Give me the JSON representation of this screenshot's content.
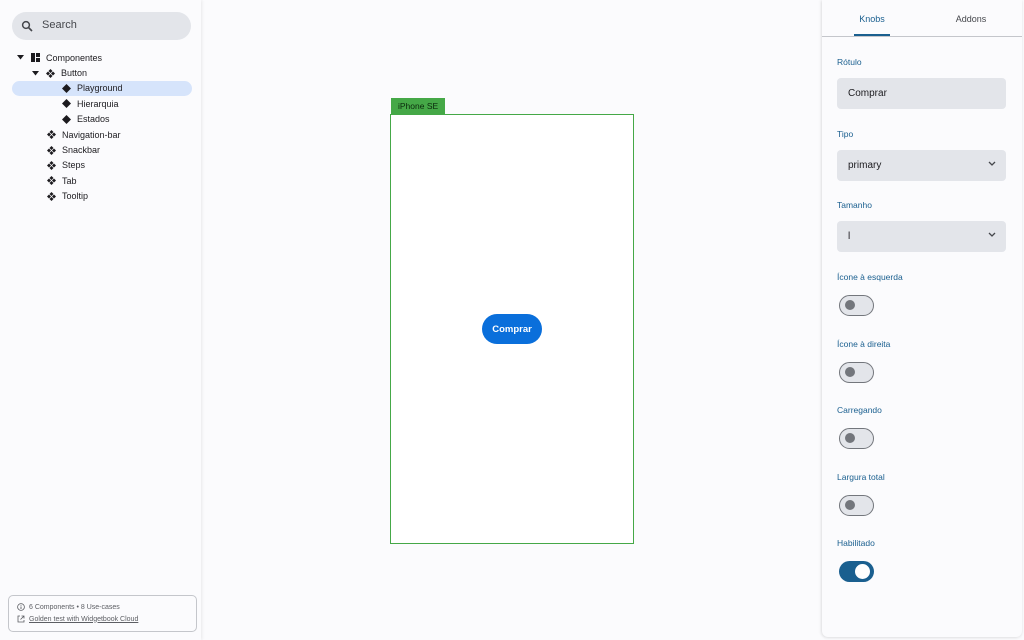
{
  "sidebar": {
    "search": {
      "placeholder": "Search"
    },
    "tree": [
      {
        "label": "Componentes",
        "depth": 0,
        "expanded": true,
        "icon": "category-icon"
      },
      {
        "label": "Button",
        "depth": 1,
        "expanded": true,
        "icon": "component-icon"
      },
      {
        "label": "Playground",
        "depth": 2,
        "icon": "use-case-icon",
        "selected": true
      },
      {
        "label": "Hierarquia",
        "depth": 2,
        "icon": "use-case-icon"
      },
      {
        "label": "Estados",
        "depth": 2,
        "icon": "use-case-icon"
      },
      {
        "label": "Navigation-bar",
        "depth": 1,
        "icon": "component-icon"
      },
      {
        "label": "Snackbar",
        "depth": 1,
        "icon": "component-icon"
      },
      {
        "label": "Steps",
        "depth": 1,
        "icon": "component-icon"
      },
      {
        "label": "Tab",
        "depth": 1,
        "icon": "component-icon"
      },
      {
        "label": "Tooltip",
        "depth": 1,
        "icon": "component-icon"
      }
    ],
    "footer": {
      "summary": "6 Components • 8 Use-cases",
      "link": "Golden test with Widgetbook Cloud"
    }
  },
  "canvas": {
    "device_name": "iPhone SE",
    "preview_button_label": "Comprar"
  },
  "panel": {
    "tabs": [
      {
        "label": "Knobs",
        "active": true
      },
      {
        "label": "Addons",
        "active": false
      }
    ],
    "knobs": {
      "rotulo": {
        "label": "Rótulo",
        "value": "Comprar"
      },
      "tipo": {
        "label": "Tipo",
        "value": "primary"
      },
      "tamanho": {
        "label": "Tamanho",
        "value": "l"
      },
      "icone_esquerda": {
        "label": "Ícone à esquerda",
        "on": false
      },
      "icone_direita": {
        "label": "Ícone à direita",
        "on": false
      },
      "carregando": {
        "label": "Carregando",
        "on": false
      },
      "largura_total": {
        "label": "Largura total",
        "on": false
      },
      "habilitado": {
        "label": "Habilitado",
        "on": true
      }
    }
  },
  "colors": {
    "accent": "#1a5f8f",
    "device_border": "#45a847",
    "preview_button": "#0a6fdb",
    "selection": "#d6e4fb"
  }
}
